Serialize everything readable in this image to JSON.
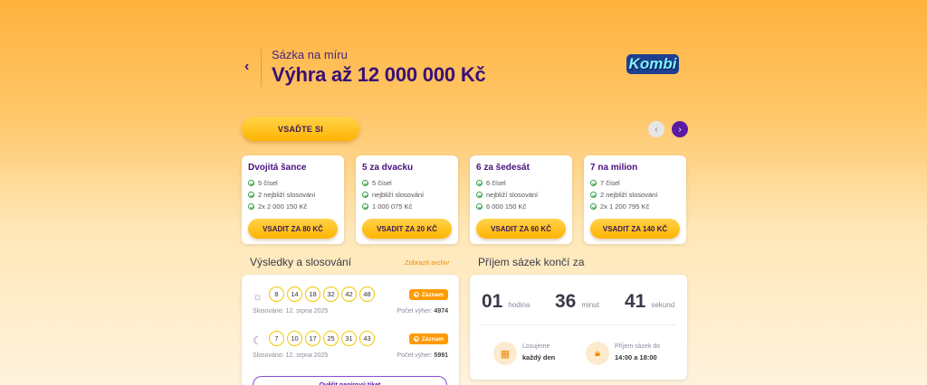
{
  "header": {
    "subtitle": "Sázka na míru",
    "title": "Výhra až 12 000 000 Kč",
    "logo_text": "Kombi",
    "back_glyph": "‹"
  },
  "bet_button": "VSAĎTE SI",
  "nav": {
    "prev": "‹",
    "next": "›"
  },
  "cards": [
    {
      "title": "Dvojitá šance",
      "lines": [
        "5 čísel",
        "2 nejbliží slosování",
        "2x 2 000 150 Kč"
      ],
      "button": "VSADIT ZA 80 KČ"
    },
    {
      "title": "5 za dvacku",
      "lines": [
        "5 čísel",
        "nejbliží slosování",
        "1 000 075 Kč"
      ],
      "button": "VSADIT ZA 20 KČ"
    },
    {
      "title": "6 za šedesát",
      "lines": [
        "6 čísel",
        "nejbliží slosování",
        "6 000 150 Kč"
      ],
      "button": "VSADIT ZA 60 KČ"
    },
    {
      "title": "7 na milion",
      "lines": [
        "7 čísel",
        "2 nejbliží slosování",
        "2x 1 200 795 Kč"
      ],
      "button": "VSADIT ZA 140 KČ"
    }
  ],
  "results": {
    "title": "Výsledky a slosování",
    "archive_link": "Zobrazit archiv",
    "draws": [
      {
        "icon": "sun-icon",
        "numbers": [
          "8",
          "14",
          "18",
          "32",
          "42",
          "48"
        ],
        "badge": "Záznam",
        "date": "Slosováno: 12. srpna 2025",
        "wins_label": "Počet výher:",
        "wins": "4974"
      },
      {
        "icon": "moon-icon",
        "numbers": [
          "7",
          "10",
          "17",
          "25",
          "31",
          "43"
        ],
        "badge": "Záznam",
        "date": "Slosováno: 12. srpna 2025",
        "wins_label": "Počet výher:",
        "wins": "5991"
      }
    ],
    "scan_button": "Ověřit papírový tiket"
  },
  "countdown": {
    "title": "Příjem sázek končí za",
    "hours": "01",
    "hours_label": "hodina",
    "minutes": "36",
    "minutes_label": "minut",
    "seconds": "41",
    "seconds_label": "sekund",
    "draw_label": "Losujeme",
    "draw_value": "každý den",
    "accept_label": "Příjem sázek do",
    "accept_value": "14:00 a 18:00"
  }
}
